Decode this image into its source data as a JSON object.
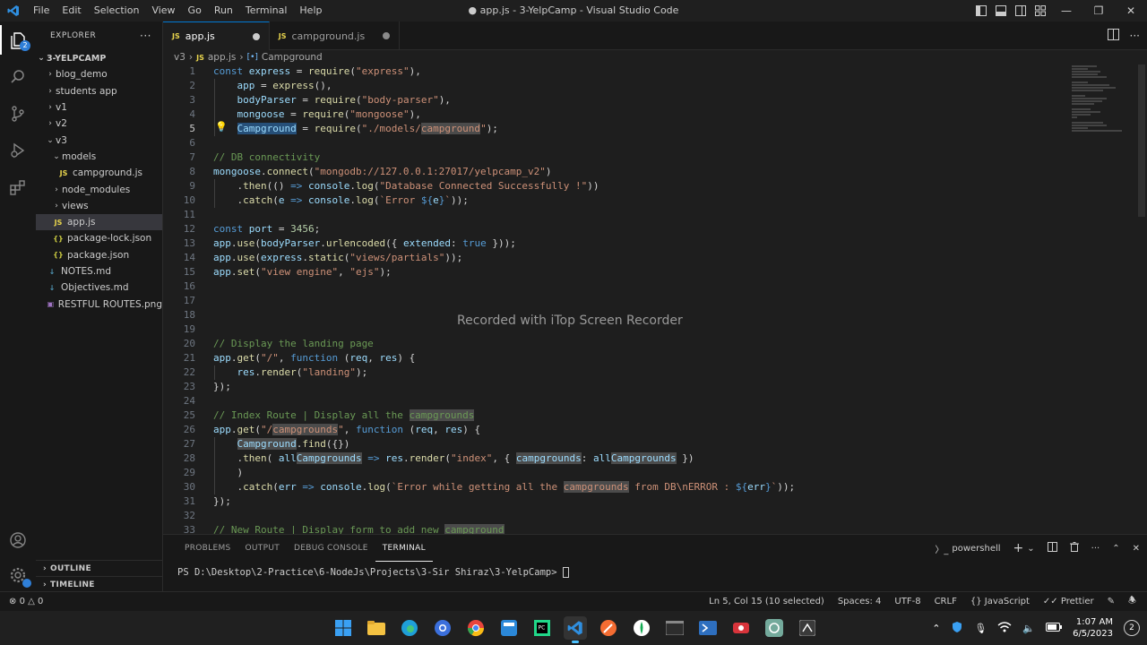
{
  "titlebar": {
    "menu": [
      "File",
      "Edit",
      "Selection",
      "View",
      "Go",
      "Run",
      "Terminal",
      "Help"
    ],
    "title": "● app.js - 3-YelpCamp - Visual Studio Code"
  },
  "activity": {
    "explorer_badge": "2"
  },
  "sidebar": {
    "header": "EXPLORER",
    "root": "3-YELPCAMP",
    "items": [
      {
        "label": "blog_demo",
        "kind": "folder"
      },
      {
        "label": "students app",
        "kind": "folder"
      },
      {
        "label": "v1",
        "kind": "folder"
      },
      {
        "label": "v2",
        "kind": "folder"
      },
      {
        "label": "v3",
        "kind": "folder-open"
      },
      {
        "label": "models",
        "kind": "folder-open"
      },
      {
        "label": "campground.js",
        "kind": "js"
      },
      {
        "label": "node_modules",
        "kind": "folder"
      },
      {
        "label": "views",
        "kind": "folder"
      },
      {
        "label": "app.js",
        "kind": "js"
      },
      {
        "label": "package-lock.json",
        "kind": "json"
      },
      {
        "label": "package.json",
        "kind": "json"
      },
      {
        "label": "NOTES.md",
        "kind": "md"
      },
      {
        "label": "Objectives.md",
        "kind": "md"
      },
      {
        "label": "RESTFUL ROUTES.png",
        "kind": "png"
      }
    ],
    "outline": "OUTLINE",
    "timeline": "TIMELINE"
  },
  "tabs": [
    {
      "label": "app.js",
      "icon": "JS"
    },
    {
      "label": "campground.js",
      "icon": "JS"
    }
  ],
  "breadcrumb": {
    "folder": "v3",
    "file": "app.js",
    "symbol": "Campground",
    "file_icon": "JS"
  },
  "editor": {
    "line_numbers": [
      "1",
      "2",
      "3",
      "4",
      "5",
      "6",
      "7",
      "8",
      "9",
      "10",
      "11",
      "12",
      "13",
      "14",
      "15",
      "16",
      "17",
      "18",
      "19",
      "20",
      "21",
      "22",
      "23",
      "24",
      "25",
      "26",
      "27",
      "28",
      "29",
      "30",
      "31",
      "32",
      "33"
    ],
    "watermark": "Recorded with iTop Screen Recorder"
  },
  "panel": {
    "tabs": [
      "PROBLEMS",
      "OUTPUT",
      "DEBUG CONSOLE",
      "TERMINAL"
    ],
    "shell": "powershell",
    "prompt": "PS D:\\Desktop\\2-Practice\\6-NodeJs\\Projects\\3-Sir Shiraz\\3-YelpCamp> "
  },
  "statusbar": {
    "errors": "0",
    "warnings": "0",
    "position": "Ln 5, Col 15 (10 selected)",
    "spaces": "Spaces: 4",
    "encoding": "UTF-8",
    "eol": "CRLF",
    "language": "JavaScript",
    "formatter": "Prettier"
  },
  "taskbar": {
    "time": "1:07 AM",
    "date": "6/5/2023",
    "notifications": "2"
  },
  "colors": {
    "accent": "#0078d4",
    "keyword": "#569cd6",
    "string": "#ce9178",
    "comment": "#6a9955"
  }
}
